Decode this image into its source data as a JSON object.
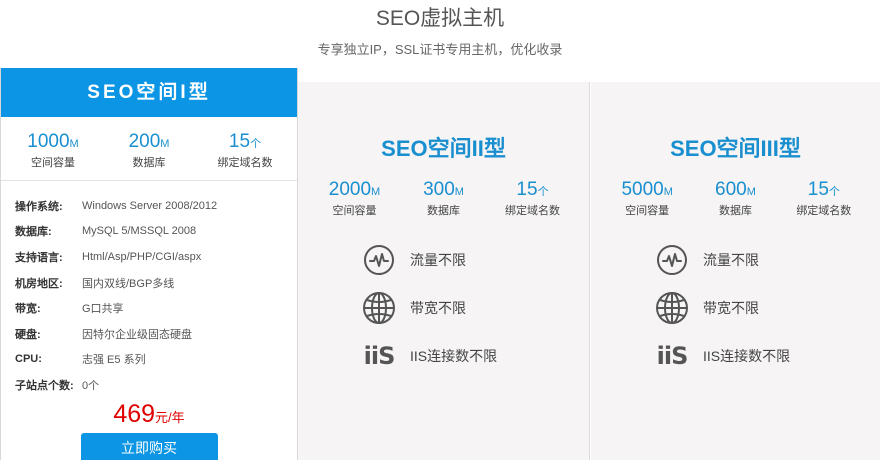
{
  "header": {
    "title": "SEO虚拟主机",
    "subtitle": "专享独立IP，SSL证书专用主机，优化收录"
  },
  "plan1": {
    "name": "SEO空间I型",
    "stats": [
      {
        "num": "1000",
        "unit": "M",
        "label": "空间容量"
      },
      {
        "num": "200",
        "unit": "M",
        "label": "数据库"
      },
      {
        "num": "15",
        "unit": "个",
        "label": "绑定域名数"
      }
    ],
    "specs": [
      {
        "key": "操作系统:",
        "value": "Windows Server 2008/2012"
      },
      {
        "key": "数据库:",
        "value": "MySQL 5/MSSQL 2008"
      },
      {
        "key": "支持语言:",
        "value": "Html/Asp/PHP/CGI/aspx"
      },
      {
        "key": "机房地区:",
        "value": "国内双线/BGP多线"
      },
      {
        "key": "带宽:",
        "value": "G口共享"
      },
      {
        "key": "硬盘:",
        "value": "因特尔企业级固态硬盘"
      },
      {
        "key": "CPU:",
        "value": "志强 E5 系列"
      },
      {
        "key": "子站点个数:",
        "value": "0个"
      }
    ],
    "price": "469",
    "price_unit": "元/年",
    "buy_label": "立即购买"
  },
  "plan2": {
    "name": "SEO空间II型",
    "stats": [
      {
        "num": "2000",
        "unit": "M",
        "label": "空间容量"
      },
      {
        "num": "300",
        "unit": "M",
        "label": "数据库"
      },
      {
        "num": "15",
        "unit": "个",
        "label": "绑定域名数"
      }
    ],
    "features": [
      {
        "icon": "pulse-icon",
        "label": "流量不限"
      },
      {
        "icon": "globe-icon",
        "label": "带宽不限"
      },
      {
        "icon": "iis-icon",
        "label": "IIS连接数不限"
      }
    ]
  },
  "plan3": {
    "name": "SEO空间III型",
    "stats": [
      {
        "num": "5000",
        "unit": "M",
        "label": "空间容量"
      },
      {
        "num": "600",
        "unit": "M",
        "label": "数据库"
      },
      {
        "num": "15",
        "unit": "个",
        "label": "绑定域名数"
      }
    ],
    "features": [
      {
        "icon": "pulse-icon",
        "label": "流量不限"
      },
      {
        "icon": "globe-icon",
        "label": "带宽不限"
      },
      {
        "icon": "iis-icon",
        "label": "IIS连接数不限"
      }
    ]
  },
  "iis_icon_text": "iiS",
  "colors": {
    "accent": "#0b95e4",
    "price": "#e00000",
    "alt_bg": "#f6f4f4"
  }
}
